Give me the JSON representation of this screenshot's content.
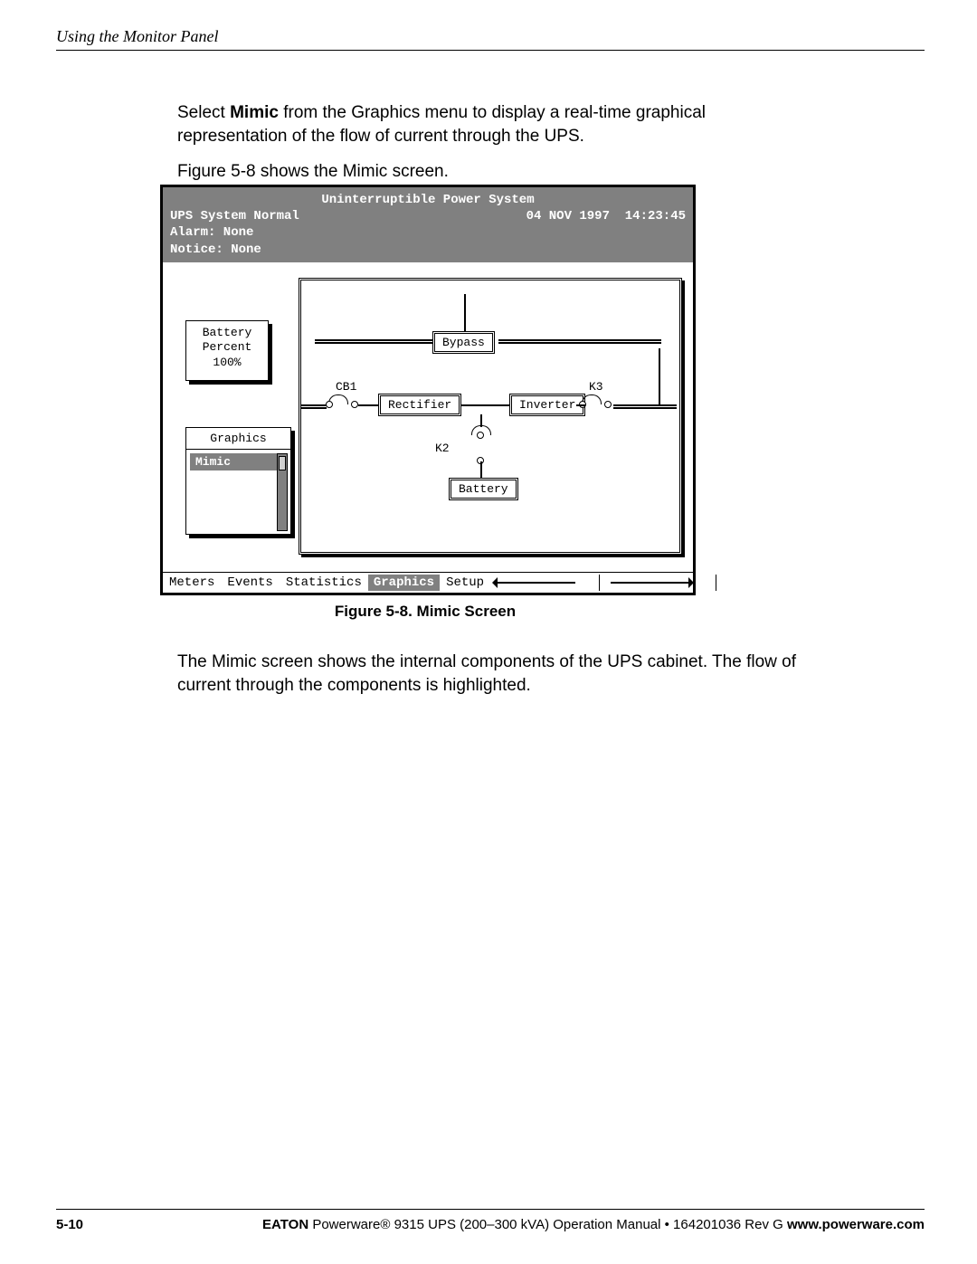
{
  "running_head": "Using the Monitor Panel",
  "p1a": "Select ",
  "p1_bold": "Mimic",
  "p1b": " from the Graphics menu to display a real-time graphical representation of the flow of current through the UPS.",
  "p2": "Figure 5-8 shows the Mimic screen.",
  "screen": {
    "title": "Uninterruptible Power System",
    "status": "UPS System Normal",
    "datetime": "04 NOV 1997  14:23:45",
    "alarm": "Alarm:  None",
    "notice": "Notice: None",
    "battery_l1": "Battery",
    "battery_l2": "Percent",
    "battery_l3": "100%",
    "menu_title": "Graphics",
    "menu_selected": "Mimic",
    "node_bypass": "Bypass",
    "node_rectifier": "Rectifier",
    "node_inverter": "Inverter",
    "node_battery": "Battery",
    "lbl_cb1": "CB1",
    "lbl_k2": "K2",
    "lbl_k3": "K3",
    "tabs": [
      "Meters",
      "Events",
      "Statistics",
      "Graphics",
      "Setup"
    ],
    "tab_selected": "Graphics"
  },
  "fig_caption": "Figure 5-8. Mimic Screen",
  "p3": "The Mimic screen shows the internal components of the UPS cabinet. The flow of current through the components is highlighted.",
  "footer": {
    "pagenum": "5-10",
    "brand": "EATON",
    "mid": " Powerware® 9315 UPS (200–300 kVA) Operation Manual  •  164201036 Rev G  ",
    "url": "www.powerware.com"
  }
}
